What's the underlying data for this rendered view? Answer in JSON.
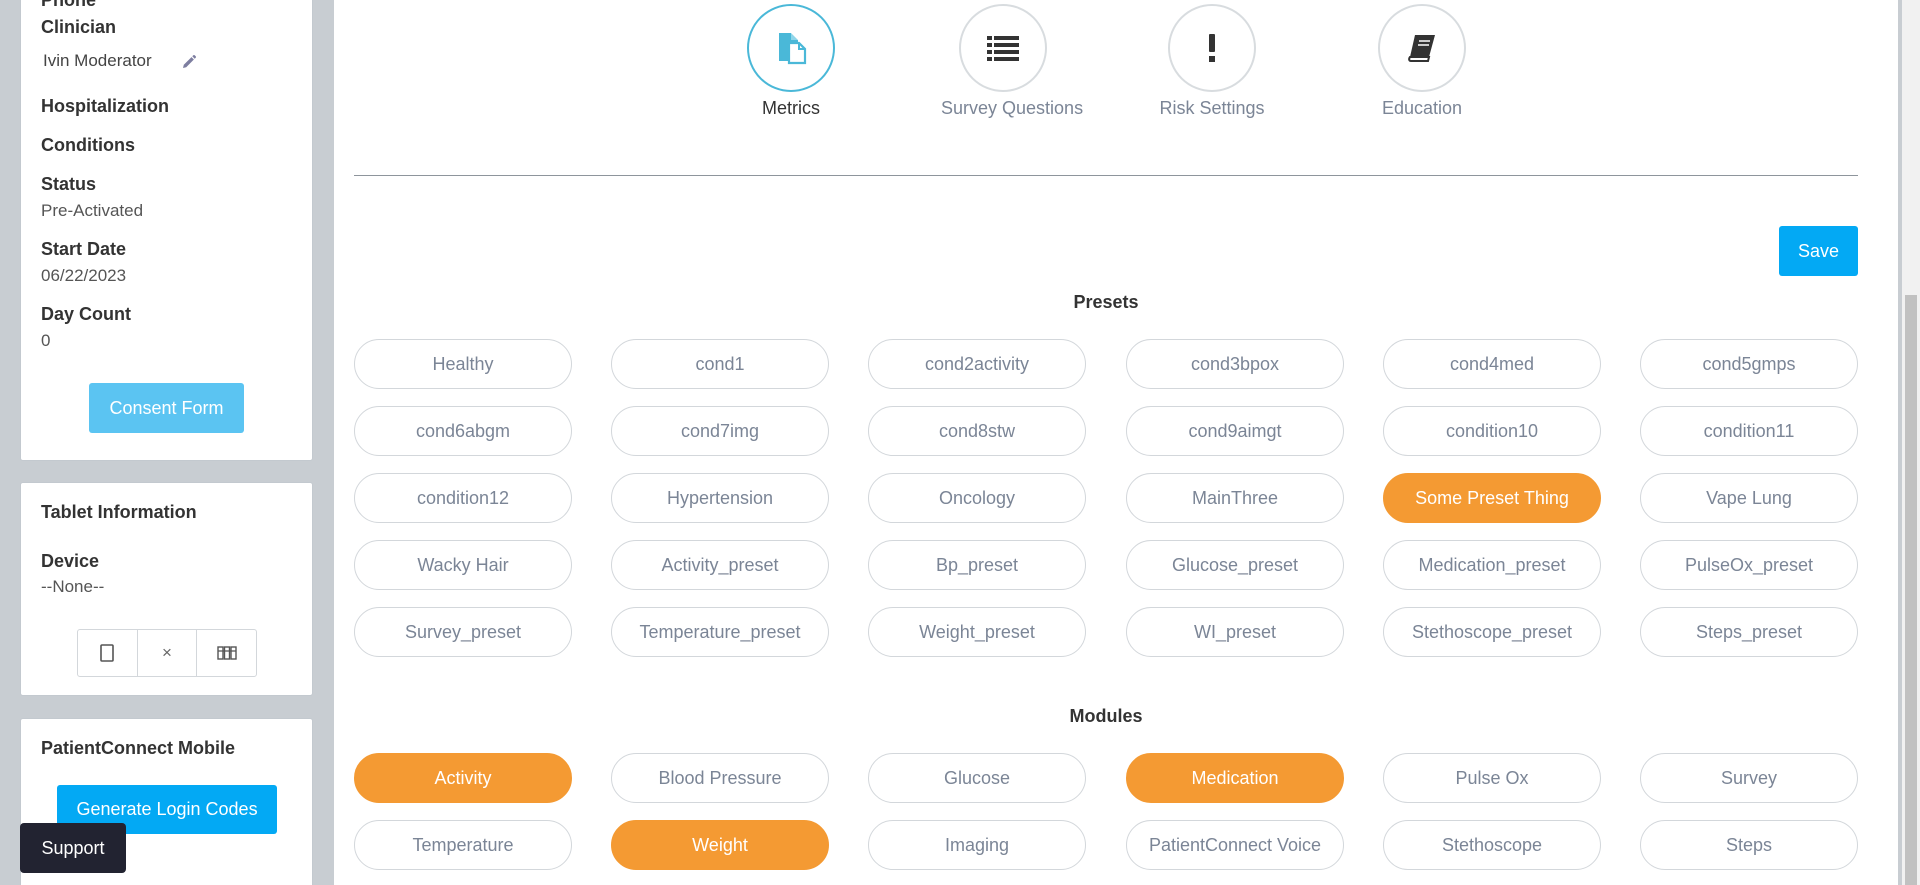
{
  "patient": {
    "phone_label": "Phone",
    "clinician_label": "Clinician",
    "clinician_value": "Ivin Moderator",
    "hospitalization_label": "Hospitalization",
    "conditions_label": "Conditions",
    "status_label": "Status",
    "status_value": "Pre-Activated",
    "start_date_label": "Start Date",
    "start_date_value": "06/22/2023",
    "day_count_label": "Day Count",
    "day_count_value": "0",
    "consent_button": "Consent Form"
  },
  "tablet": {
    "title": "Tablet Information",
    "device_label": "Device",
    "device_value": "--None--",
    "buttons": [
      "tablet-icon",
      "close-icon",
      "barcode-icon"
    ],
    "close_glyph": "×"
  },
  "mobile": {
    "title": "PatientConnect Mobile",
    "login_button": "Generate Login Codes"
  },
  "support_button": "Support",
  "tabs": [
    {
      "label": "Metrics",
      "icon": "metrics-document-icon",
      "active": true
    },
    {
      "label": "Survey Questions",
      "icon": "list-icon",
      "active": false
    },
    {
      "label": "Risk Settings",
      "icon": "exclamation-icon",
      "active": false
    },
    {
      "label": "Education",
      "icon": "book-icon",
      "active": false
    }
  ],
  "save_button": "Save",
  "presets_title": "Presets",
  "presets": [
    {
      "label": "Healthy",
      "selected": false
    },
    {
      "label": "cond1",
      "selected": false
    },
    {
      "label": "cond2activity",
      "selected": false
    },
    {
      "label": "cond3bpox",
      "selected": false
    },
    {
      "label": "cond4med",
      "selected": false
    },
    {
      "label": "cond5gmps",
      "selected": false
    },
    {
      "label": "cond6abgm",
      "selected": false
    },
    {
      "label": "cond7img",
      "selected": false
    },
    {
      "label": "cond8stw",
      "selected": false
    },
    {
      "label": "cond9aimgt",
      "selected": false
    },
    {
      "label": "condition10",
      "selected": false
    },
    {
      "label": "condition11",
      "selected": false
    },
    {
      "label": "condition12",
      "selected": false
    },
    {
      "label": "Hypertension",
      "selected": false
    },
    {
      "label": "Oncology",
      "selected": false
    },
    {
      "label": "MainThree",
      "selected": false
    },
    {
      "label": "Some Preset Thing",
      "selected": true
    },
    {
      "label": "Vape Lung",
      "selected": false
    },
    {
      "label": "Wacky Hair",
      "selected": false
    },
    {
      "label": "Activity_preset",
      "selected": false
    },
    {
      "label": "Bp_preset",
      "selected": false
    },
    {
      "label": "Glucose_preset",
      "selected": false
    },
    {
      "label": "Medication_preset",
      "selected": false
    },
    {
      "label": "PulseOx_preset",
      "selected": false
    },
    {
      "label": "Survey_preset",
      "selected": false
    },
    {
      "label": "Temperature_preset",
      "selected": false
    },
    {
      "label": "Weight_preset",
      "selected": false
    },
    {
      "label": "WI_preset",
      "selected": false
    },
    {
      "label": "Stethoscope_preset",
      "selected": false
    },
    {
      "label": "Steps_preset",
      "selected": false
    }
  ],
  "modules_title": "Modules",
  "modules": [
    {
      "label": "Activity",
      "selected": true
    },
    {
      "label": "Blood Pressure",
      "selected": false
    },
    {
      "label": "Glucose",
      "selected": false
    },
    {
      "label": "Medication",
      "selected": true
    },
    {
      "label": "Pulse Ox",
      "selected": false
    },
    {
      "label": "Survey",
      "selected": false
    },
    {
      "label": "Temperature",
      "selected": false
    },
    {
      "label": "Weight",
      "selected": true
    },
    {
      "label": "Imaging",
      "selected": false
    },
    {
      "label": "PatientConnect Voice",
      "selected": false
    },
    {
      "label": "Stethoscope",
      "selected": false
    },
    {
      "label": "Steps",
      "selected": false
    }
  ],
  "colors": {
    "accent_blue": "#03a9f4",
    "consent_blue": "#5bc4f2",
    "selected_orange": "#f49a33",
    "active_tab_ring": "#4ab8d8"
  }
}
